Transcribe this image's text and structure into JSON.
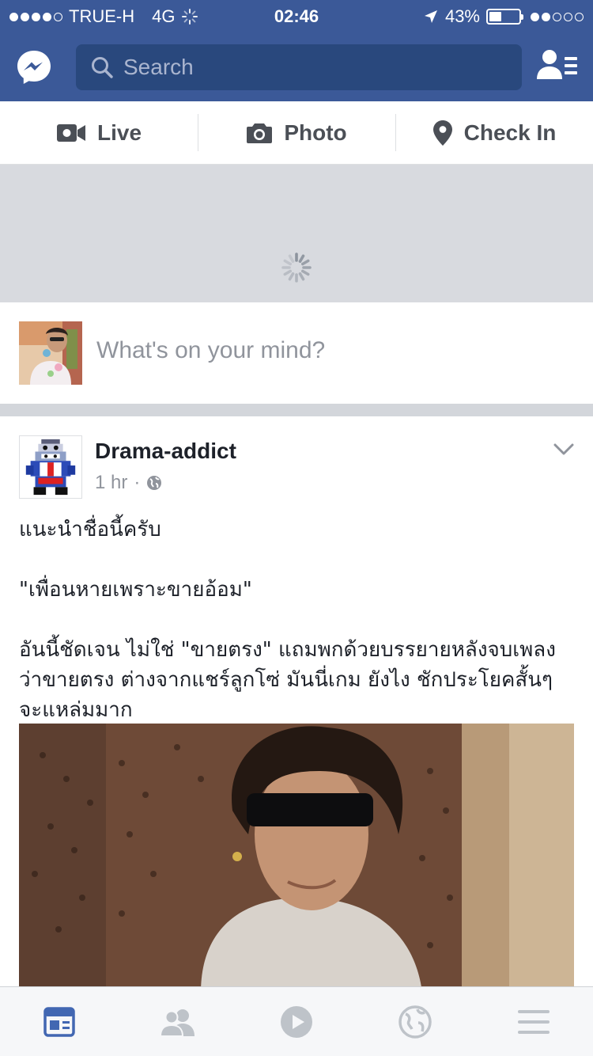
{
  "status_bar": {
    "carrier": "TRUE-H",
    "network": "4G",
    "time": "02:46",
    "battery": "43%",
    "battery_level": 0.43
  },
  "nav": {
    "search_placeholder": "Search"
  },
  "composer": {
    "tabs": [
      {
        "label": "Live",
        "icon": "video-camera-icon"
      },
      {
        "label": "Photo",
        "icon": "camera-icon"
      },
      {
        "label": "Check In",
        "icon": "location-pin-icon"
      }
    ],
    "prompt": "What's on your mind?"
  },
  "post": {
    "author": "Drama-addict",
    "time": "1 hr",
    "separator": "·",
    "lines": [
      "แนะนำชื่อนี้ครับ",
      "\"เพื่อนหายเพราะขายอ้อม\"",
      "อันนี้ชัดเจน ไม่ใช่ \"ขายตรง\" แถมพกด้วยบรรยายหลังจบเพลง",
      "ว่าขายตรง ต่างจากแชร์ลูกโซ่ มันนี่เกม ยังไง ชักประโยคสั้นๆ",
      "จะแหล่มมาก"
    ]
  },
  "tabbar": {
    "items": [
      "news-feed-icon",
      "friends-icon",
      "video-icon",
      "notifications-globe-icon",
      "menu-icon"
    ],
    "active_color": "#4267b2",
    "inactive_color": "#bec3c9"
  },
  "colors": {
    "brand": "#3b5998",
    "search_bg": "#29487d"
  }
}
